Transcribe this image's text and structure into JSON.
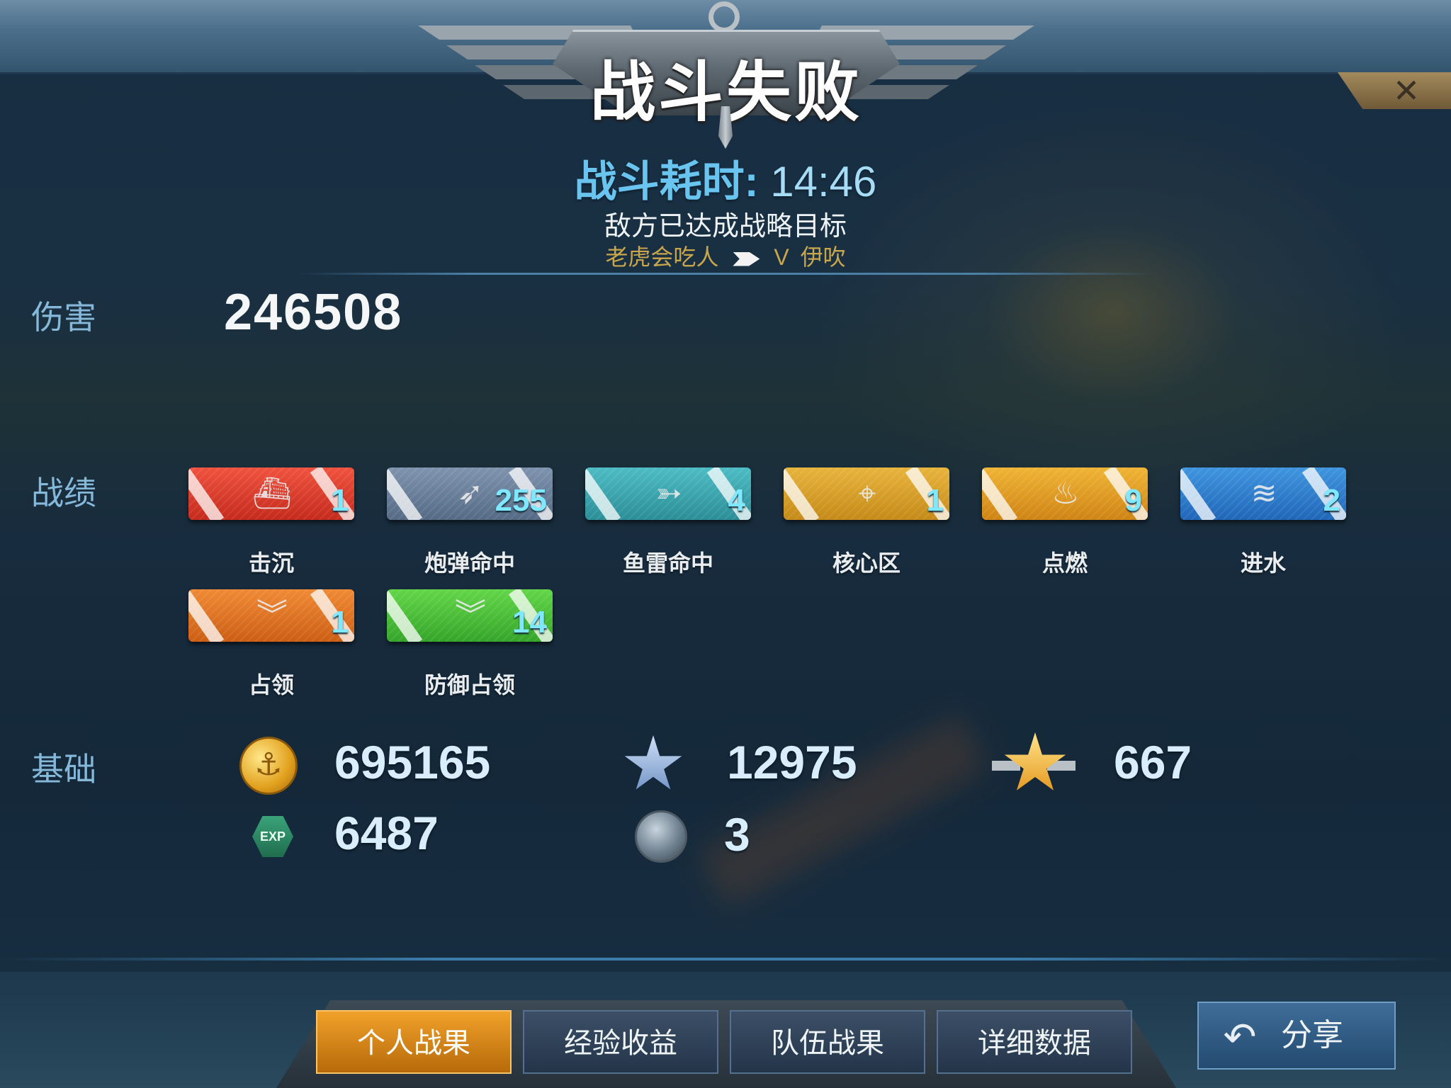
{
  "header": {
    "title": "战斗失败",
    "duration_label": "战斗耗时:",
    "duration_value": "14:46",
    "result_desc": "敌方已达成战略目标",
    "player_a": "老虎会吃人",
    "vs": "V",
    "player_b": "伊吹"
  },
  "damage": {
    "label": "伤害",
    "value": "246508"
  },
  "record": {
    "label": "战绩",
    "badges": [
      {
        "label": "击沉",
        "count": "1",
        "color": "#e0402d",
        "icon": "ship-icon"
      },
      {
        "label": "炮弹命中",
        "count": "255",
        "color": "#6b819b",
        "icon": "shell-icon"
      },
      {
        "label": "鱼雷命中",
        "count": "4",
        "color": "#3aa8b1",
        "icon": "torpedo-icon"
      },
      {
        "label": "核心区",
        "count": "1",
        "color": "#d9a02a",
        "icon": "core-icon"
      },
      {
        "label": "点燃",
        "count": "9",
        "color": "#e0a024",
        "icon": "fire-icon"
      },
      {
        "label": "进水",
        "count": "2",
        "color": "#2f7fcc",
        "icon": "water-icon"
      },
      {
        "label": "占领",
        "count": "1",
        "color": "#e07224",
        "icon": "capture-icon"
      },
      {
        "label": "防御占领",
        "count": "14",
        "color": "#4cc139",
        "icon": "defend-capture-icon"
      }
    ]
  },
  "basic": {
    "label": "基础",
    "coins": "695165",
    "exp": "6487",
    "merit": "12975",
    "rank_points": "667",
    "globe": "3",
    "exp_icon_text": "EXP"
  },
  "tabs": [
    {
      "label": "个人战果",
      "active": true
    },
    {
      "label": "经验收益",
      "active": false
    },
    {
      "label": "队伍战果",
      "active": false
    },
    {
      "label": "详细数据",
      "active": false
    }
  ],
  "share": {
    "label": "分享"
  },
  "colors": {
    "accent_blue": "#69c5ef",
    "gold_text": "#c9a64c",
    "tab_active": "#e8941e"
  }
}
